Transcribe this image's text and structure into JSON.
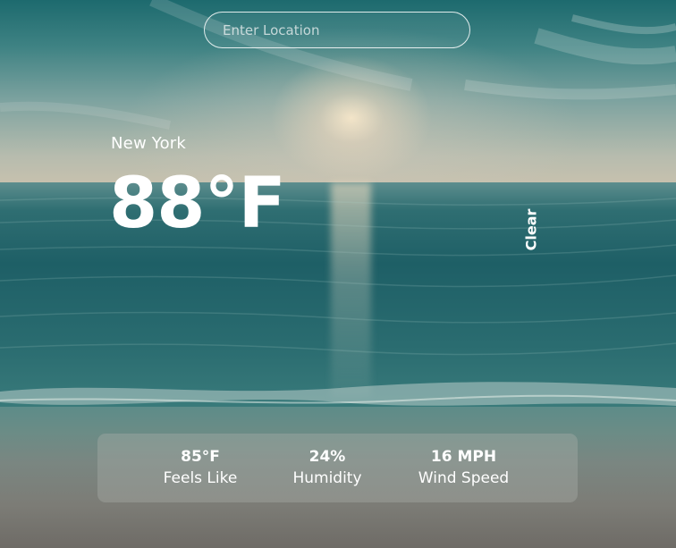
{
  "search": {
    "placeholder": "Enter Location",
    "value": ""
  },
  "weather": {
    "location": "New York",
    "temperature": "88°F",
    "condition": "Clear"
  },
  "stats": {
    "feels_like": {
      "value": "85°F",
      "label": "Feels Like"
    },
    "humidity": {
      "value": "24%",
      "label": "Humidity"
    },
    "wind": {
      "value": "16 MPH",
      "label": "Wind Speed"
    }
  },
  "colors": {
    "text": "#ffffff",
    "sea": "#1e5f66",
    "sky_top": "#1d6a6e",
    "sun": "#ffecd0",
    "panel": "#aaafac"
  }
}
